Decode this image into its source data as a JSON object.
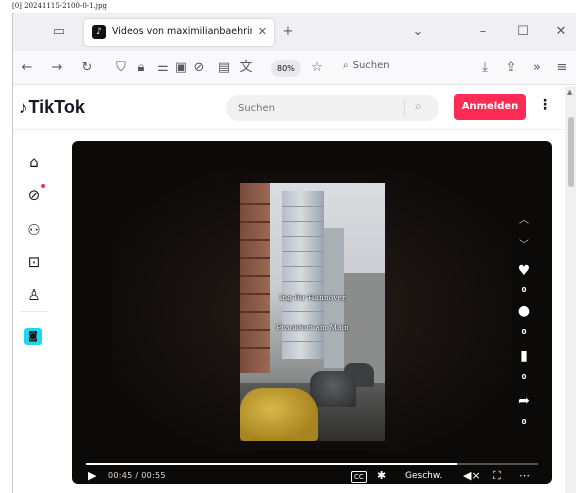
{
  "screenshot_caption": "[0] 20241115-2100-0-1.jpg",
  "browser": {
    "tab_title": "Videos von maximilianbaehring",
    "tab_favicon": "tiktok-icon",
    "new_tab": "+",
    "window_controls": [
      "–",
      "☐",
      "✕"
    ],
    "zoom": "80%",
    "search_placeholder": "Suchen"
  },
  "tiktok": {
    "logo": "TikTok",
    "search_placeholder": "Suchen",
    "login_label": "Anmelden",
    "sidebar_icons": [
      "home-icon",
      "explore-icon",
      "following-icon",
      "live-icon",
      "profile-icon",
      "collapsed-avatar-icon"
    ],
    "video": {
      "caption_line1": "Ing für Hannover",
      "caption_line2": "Frankfurt am Main",
      "likes": "0",
      "comments": "0",
      "saves": "0",
      "shares": "0",
      "current_time": "00:45",
      "duration": "00:55",
      "time_display": "00:45 / 00:55",
      "progress": 0.82,
      "speed_label": "Geschw."
    }
  },
  "colors": {
    "brand": "#fe2c55",
    "tab_bg": "#f0f0f4",
    "player_bg": "#0c0a09"
  }
}
